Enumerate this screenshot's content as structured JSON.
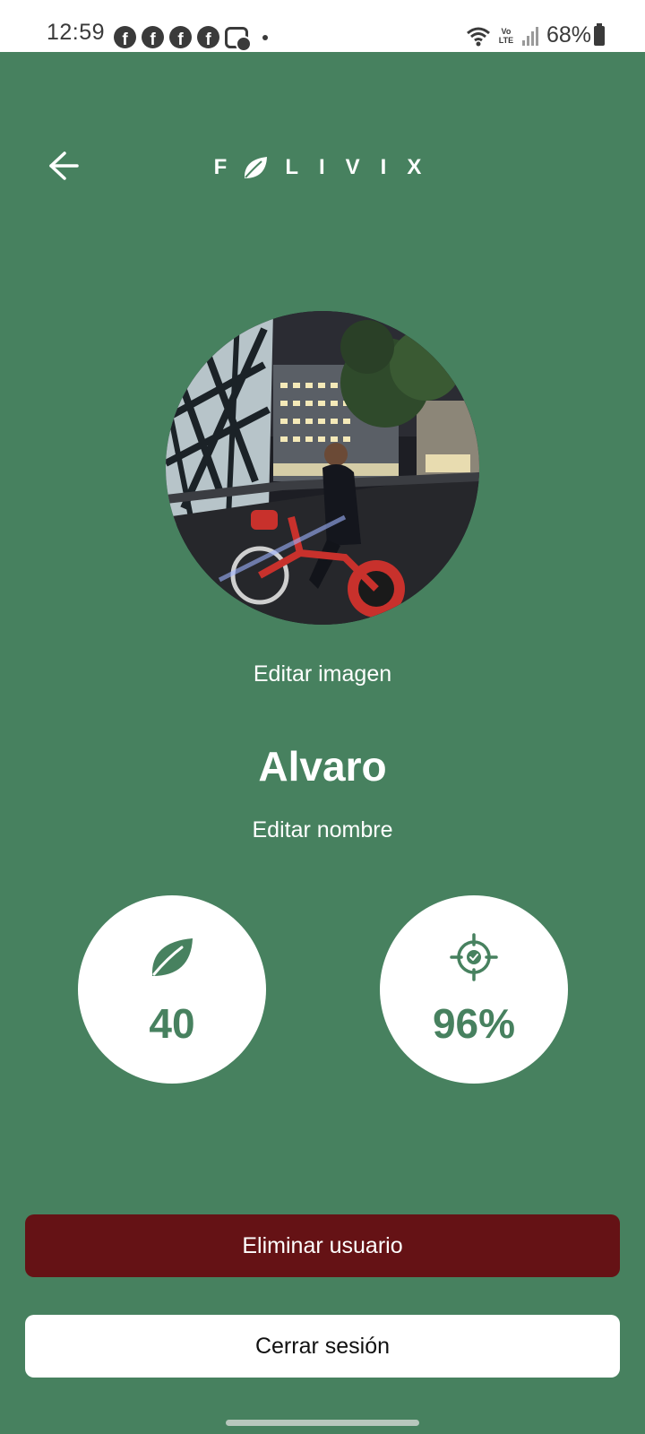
{
  "status_bar": {
    "time": "12:59",
    "battery": "68%",
    "network": "Vo LTE",
    "notification_icons": [
      "facebook-icon",
      "facebook-icon",
      "facebook-icon",
      "facebook-icon",
      "messenger-icon",
      "dot-icon"
    ]
  },
  "header": {
    "logo_text": "FOLIVIX",
    "logo_prefix": "F",
    "logo_suffix": "LIVIX",
    "back_icon": "arrow-left-icon"
  },
  "profile": {
    "edit_image_label": "Editar imagen",
    "name": "Alvaro",
    "edit_name_label": "Editar nombre"
  },
  "stats": {
    "leaves": {
      "icon": "leaf-icon",
      "value": "40"
    },
    "accuracy": {
      "icon": "target-check-icon",
      "value": "96%"
    }
  },
  "actions": {
    "delete_label": "Eliminar usuario",
    "logout_label": "Cerrar sesión"
  },
  "colors": {
    "background": "#47815f",
    "delete_button": "#651215",
    "logout_button": "#ffffff",
    "accent": "#47815f"
  }
}
